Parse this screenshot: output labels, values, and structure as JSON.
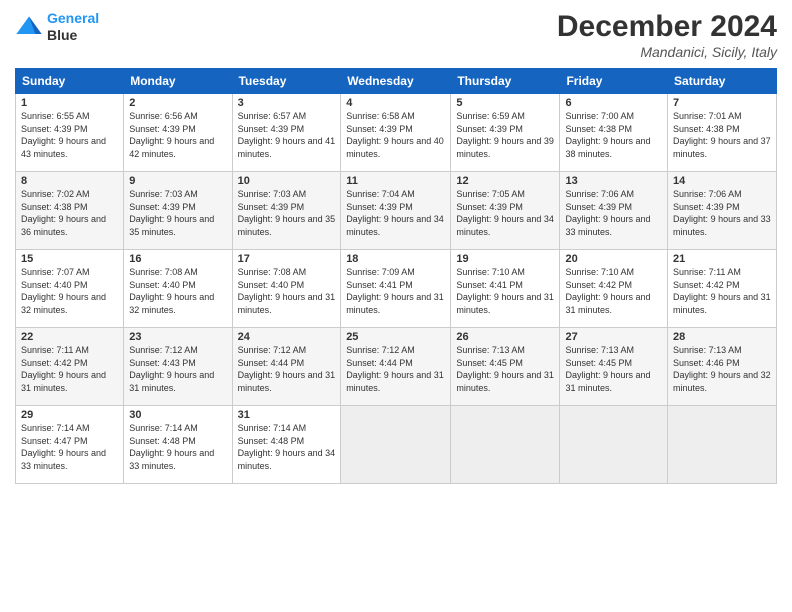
{
  "logo": {
    "line1": "General",
    "line2": "Blue"
  },
  "title": "December 2024",
  "subtitle": "Mandanici, Sicily, Italy",
  "days_of_week": [
    "Sunday",
    "Monday",
    "Tuesday",
    "Wednesday",
    "Thursday",
    "Friday",
    "Saturday"
  ],
  "weeks": [
    [
      {
        "day": 1,
        "sunrise": "6:55 AM",
        "sunset": "4:39 PM",
        "daylight": "9 hours and 43 minutes."
      },
      {
        "day": 2,
        "sunrise": "6:56 AM",
        "sunset": "4:39 PM",
        "daylight": "9 hours and 42 minutes."
      },
      {
        "day": 3,
        "sunrise": "6:57 AM",
        "sunset": "4:39 PM",
        "daylight": "9 hours and 41 minutes."
      },
      {
        "day": 4,
        "sunrise": "6:58 AM",
        "sunset": "4:39 PM",
        "daylight": "9 hours and 40 minutes."
      },
      {
        "day": 5,
        "sunrise": "6:59 AM",
        "sunset": "4:39 PM",
        "daylight": "9 hours and 39 minutes."
      },
      {
        "day": 6,
        "sunrise": "7:00 AM",
        "sunset": "4:38 PM",
        "daylight": "9 hours and 38 minutes."
      },
      {
        "day": 7,
        "sunrise": "7:01 AM",
        "sunset": "4:38 PM",
        "daylight": "9 hours and 37 minutes."
      }
    ],
    [
      {
        "day": 8,
        "sunrise": "7:02 AM",
        "sunset": "4:38 PM",
        "daylight": "9 hours and 36 minutes."
      },
      {
        "day": 9,
        "sunrise": "7:03 AM",
        "sunset": "4:39 PM",
        "daylight": "9 hours and 35 minutes."
      },
      {
        "day": 10,
        "sunrise": "7:03 AM",
        "sunset": "4:39 PM",
        "daylight": "9 hours and 35 minutes."
      },
      {
        "day": 11,
        "sunrise": "7:04 AM",
        "sunset": "4:39 PM",
        "daylight": "9 hours and 34 minutes."
      },
      {
        "day": 12,
        "sunrise": "7:05 AM",
        "sunset": "4:39 PM",
        "daylight": "9 hours and 34 minutes."
      },
      {
        "day": 13,
        "sunrise": "7:06 AM",
        "sunset": "4:39 PM",
        "daylight": "9 hours and 33 minutes."
      },
      {
        "day": 14,
        "sunrise": "7:06 AM",
        "sunset": "4:39 PM",
        "daylight": "9 hours and 33 minutes."
      }
    ],
    [
      {
        "day": 15,
        "sunrise": "7:07 AM",
        "sunset": "4:40 PM",
        "daylight": "9 hours and 32 minutes."
      },
      {
        "day": 16,
        "sunrise": "7:08 AM",
        "sunset": "4:40 PM",
        "daylight": "9 hours and 32 minutes."
      },
      {
        "day": 17,
        "sunrise": "7:08 AM",
        "sunset": "4:40 PM",
        "daylight": "9 hours and 31 minutes."
      },
      {
        "day": 18,
        "sunrise": "7:09 AM",
        "sunset": "4:41 PM",
        "daylight": "9 hours and 31 minutes."
      },
      {
        "day": 19,
        "sunrise": "7:10 AM",
        "sunset": "4:41 PM",
        "daylight": "9 hours and 31 minutes."
      },
      {
        "day": 20,
        "sunrise": "7:10 AM",
        "sunset": "4:42 PM",
        "daylight": "9 hours and 31 minutes."
      },
      {
        "day": 21,
        "sunrise": "7:11 AM",
        "sunset": "4:42 PM",
        "daylight": "9 hours and 31 minutes."
      }
    ],
    [
      {
        "day": 22,
        "sunrise": "7:11 AM",
        "sunset": "4:42 PM",
        "daylight": "9 hours and 31 minutes."
      },
      {
        "day": 23,
        "sunrise": "7:12 AM",
        "sunset": "4:43 PM",
        "daylight": "9 hours and 31 minutes."
      },
      {
        "day": 24,
        "sunrise": "7:12 AM",
        "sunset": "4:44 PM",
        "daylight": "9 hours and 31 minutes."
      },
      {
        "day": 25,
        "sunrise": "7:12 AM",
        "sunset": "4:44 PM",
        "daylight": "9 hours and 31 minutes."
      },
      {
        "day": 26,
        "sunrise": "7:13 AM",
        "sunset": "4:45 PM",
        "daylight": "9 hours and 31 minutes."
      },
      {
        "day": 27,
        "sunrise": "7:13 AM",
        "sunset": "4:45 PM",
        "daylight": "9 hours and 31 minutes."
      },
      {
        "day": 28,
        "sunrise": "7:13 AM",
        "sunset": "4:46 PM",
        "daylight": "9 hours and 32 minutes."
      }
    ],
    [
      {
        "day": 29,
        "sunrise": "7:14 AM",
        "sunset": "4:47 PM",
        "daylight": "9 hours and 33 minutes."
      },
      {
        "day": 30,
        "sunrise": "7:14 AM",
        "sunset": "4:48 PM",
        "daylight": "9 hours and 33 minutes."
      },
      {
        "day": 31,
        "sunrise": "7:14 AM",
        "sunset": "4:48 PM",
        "daylight": "9 hours and 34 minutes."
      },
      null,
      null,
      null,
      null
    ]
  ]
}
